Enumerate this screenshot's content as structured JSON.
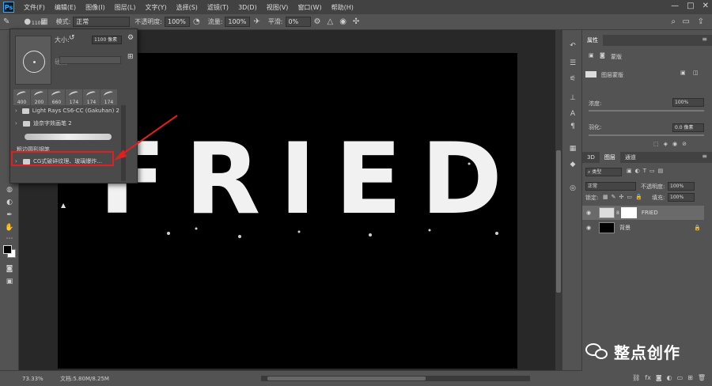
{
  "app": {
    "logo": "Ps",
    "menus": [
      "文件(F)",
      "编辑(E)",
      "图像(I)",
      "图层(L)",
      "文字(Y)",
      "选择(S)",
      "滤镜(T)",
      "3D(D)",
      "视图(V)",
      "窗口(W)",
      "帮助(H)"
    ]
  },
  "options": {
    "brush_size": "1100",
    "mode_label": "模式:",
    "mode_value": "正常",
    "opacity_label": "不透明度:",
    "opacity_value": "100%",
    "flow_label": "流量:",
    "flow_value": "100%",
    "smoothing_label": "平滑:",
    "smoothing_value": "0%"
  },
  "brush_popup": {
    "size_label": "大小:",
    "size_value": "1100 像素",
    "hardness_label": "硬度:",
    "thumb_sizes": [
      "400",
      "200",
      "660",
      "174",
      "174",
      "174"
    ],
    "folders": [
      "Light Rays CS6-CC (Gakuhan) 2",
      "迪奈字效画笔 2"
    ],
    "group_label": "粗边圆形钢笔",
    "highlighted_folder": "CG式破碎纹理、玻璃爆炸..."
  },
  "canvas": {
    "text": "FRIED",
    "background": "#000000",
    "text_color": "#f1f1f1"
  },
  "status": {
    "zoom": "73.33%",
    "doc_info": "文档:5.80M/8.25M"
  },
  "properties": {
    "title": "属性",
    "type_label": "蒙版",
    "layer_mask": "图层蒙版",
    "density_label": "浓度:",
    "density_value": "100%",
    "feather_label": "羽化:",
    "feather_value": "0.0 像素"
  },
  "layers": {
    "tabs": [
      "3D",
      "图层",
      "通道"
    ],
    "filter_value": "类型",
    "blend_mode": "正常",
    "opacity_label": "不透明度:",
    "opacity_value": "100%",
    "lock_label": "锁定:",
    "fill_label": "填充:",
    "fill_value": "100%",
    "items": [
      {
        "name": "FRIED",
        "selected": true
      },
      {
        "name": "背景",
        "selected": false
      }
    ]
  },
  "watermark": "整点创作",
  "colors": {
    "highlight": "#e02020",
    "menubar": "#424242",
    "panel": "#535353",
    "workspace": "#282828"
  }
}
